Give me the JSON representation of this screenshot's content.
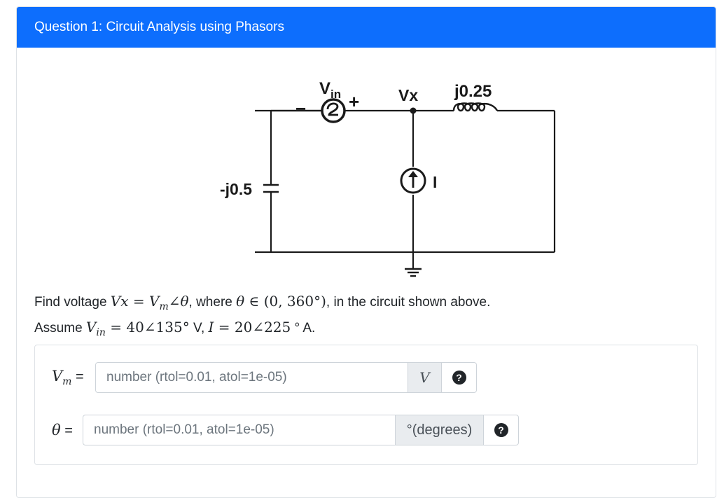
{
  "header": {
    "title": "Question 1: Circuit Analysis using Phasors"
  },
  "circuit": {
    "source_label": "V",
    "source_subscript": "in",
    "minus": "−",
    "plus": "+",
    "node_label": "Vx",
    "inductor_label": "j0.25",
    "capacitor_label": "-j0.5",
    "current_label": "I"
  },
  "problem": {
    "line1_prefix": "Find voltage ",
    "line1_math": "Vx = V",
    "line1_math_sub": "m",
    "line1_angle": "∠θ",
    "line1_mid": ", where ",
    "line1_theta": "θ",
    "line1_range": " ∈ (0, 360°)",
    "line1_suffix": ", in the circuit shown above.",
    "line2_prefix": "Assume ",
    "line2_vin": "V",
    "line2_vin_sub": "in",
    "line2_vin_value": " = 40∠135°",
    "line2_mid": " V, ",
    "line2_i": "I",
    "line2_i_value": " = 20∠225",
    "line2_suffix": " ° A."
  },
  "answers": {
    "vm": {
      "label_var": "V",
      "label_sub": "m",
      "label_eq": " =",
      "placeholder": "number (rtol=0.01, atol=1e-05)",
      "unit": "V",
      "help": "?"
    },
    "theta": {
      "label_var": "θ",
      "label_eq": " =",
      "placeholder": "number (rtol=0.01, atol=1e-05)",
      "unit": "°(degrees)",
      "help": "?"
    }
  },
  "colors": {
    "header_bg": "#0d6efd",
    "header_text": "#ffffff"
  }
}
